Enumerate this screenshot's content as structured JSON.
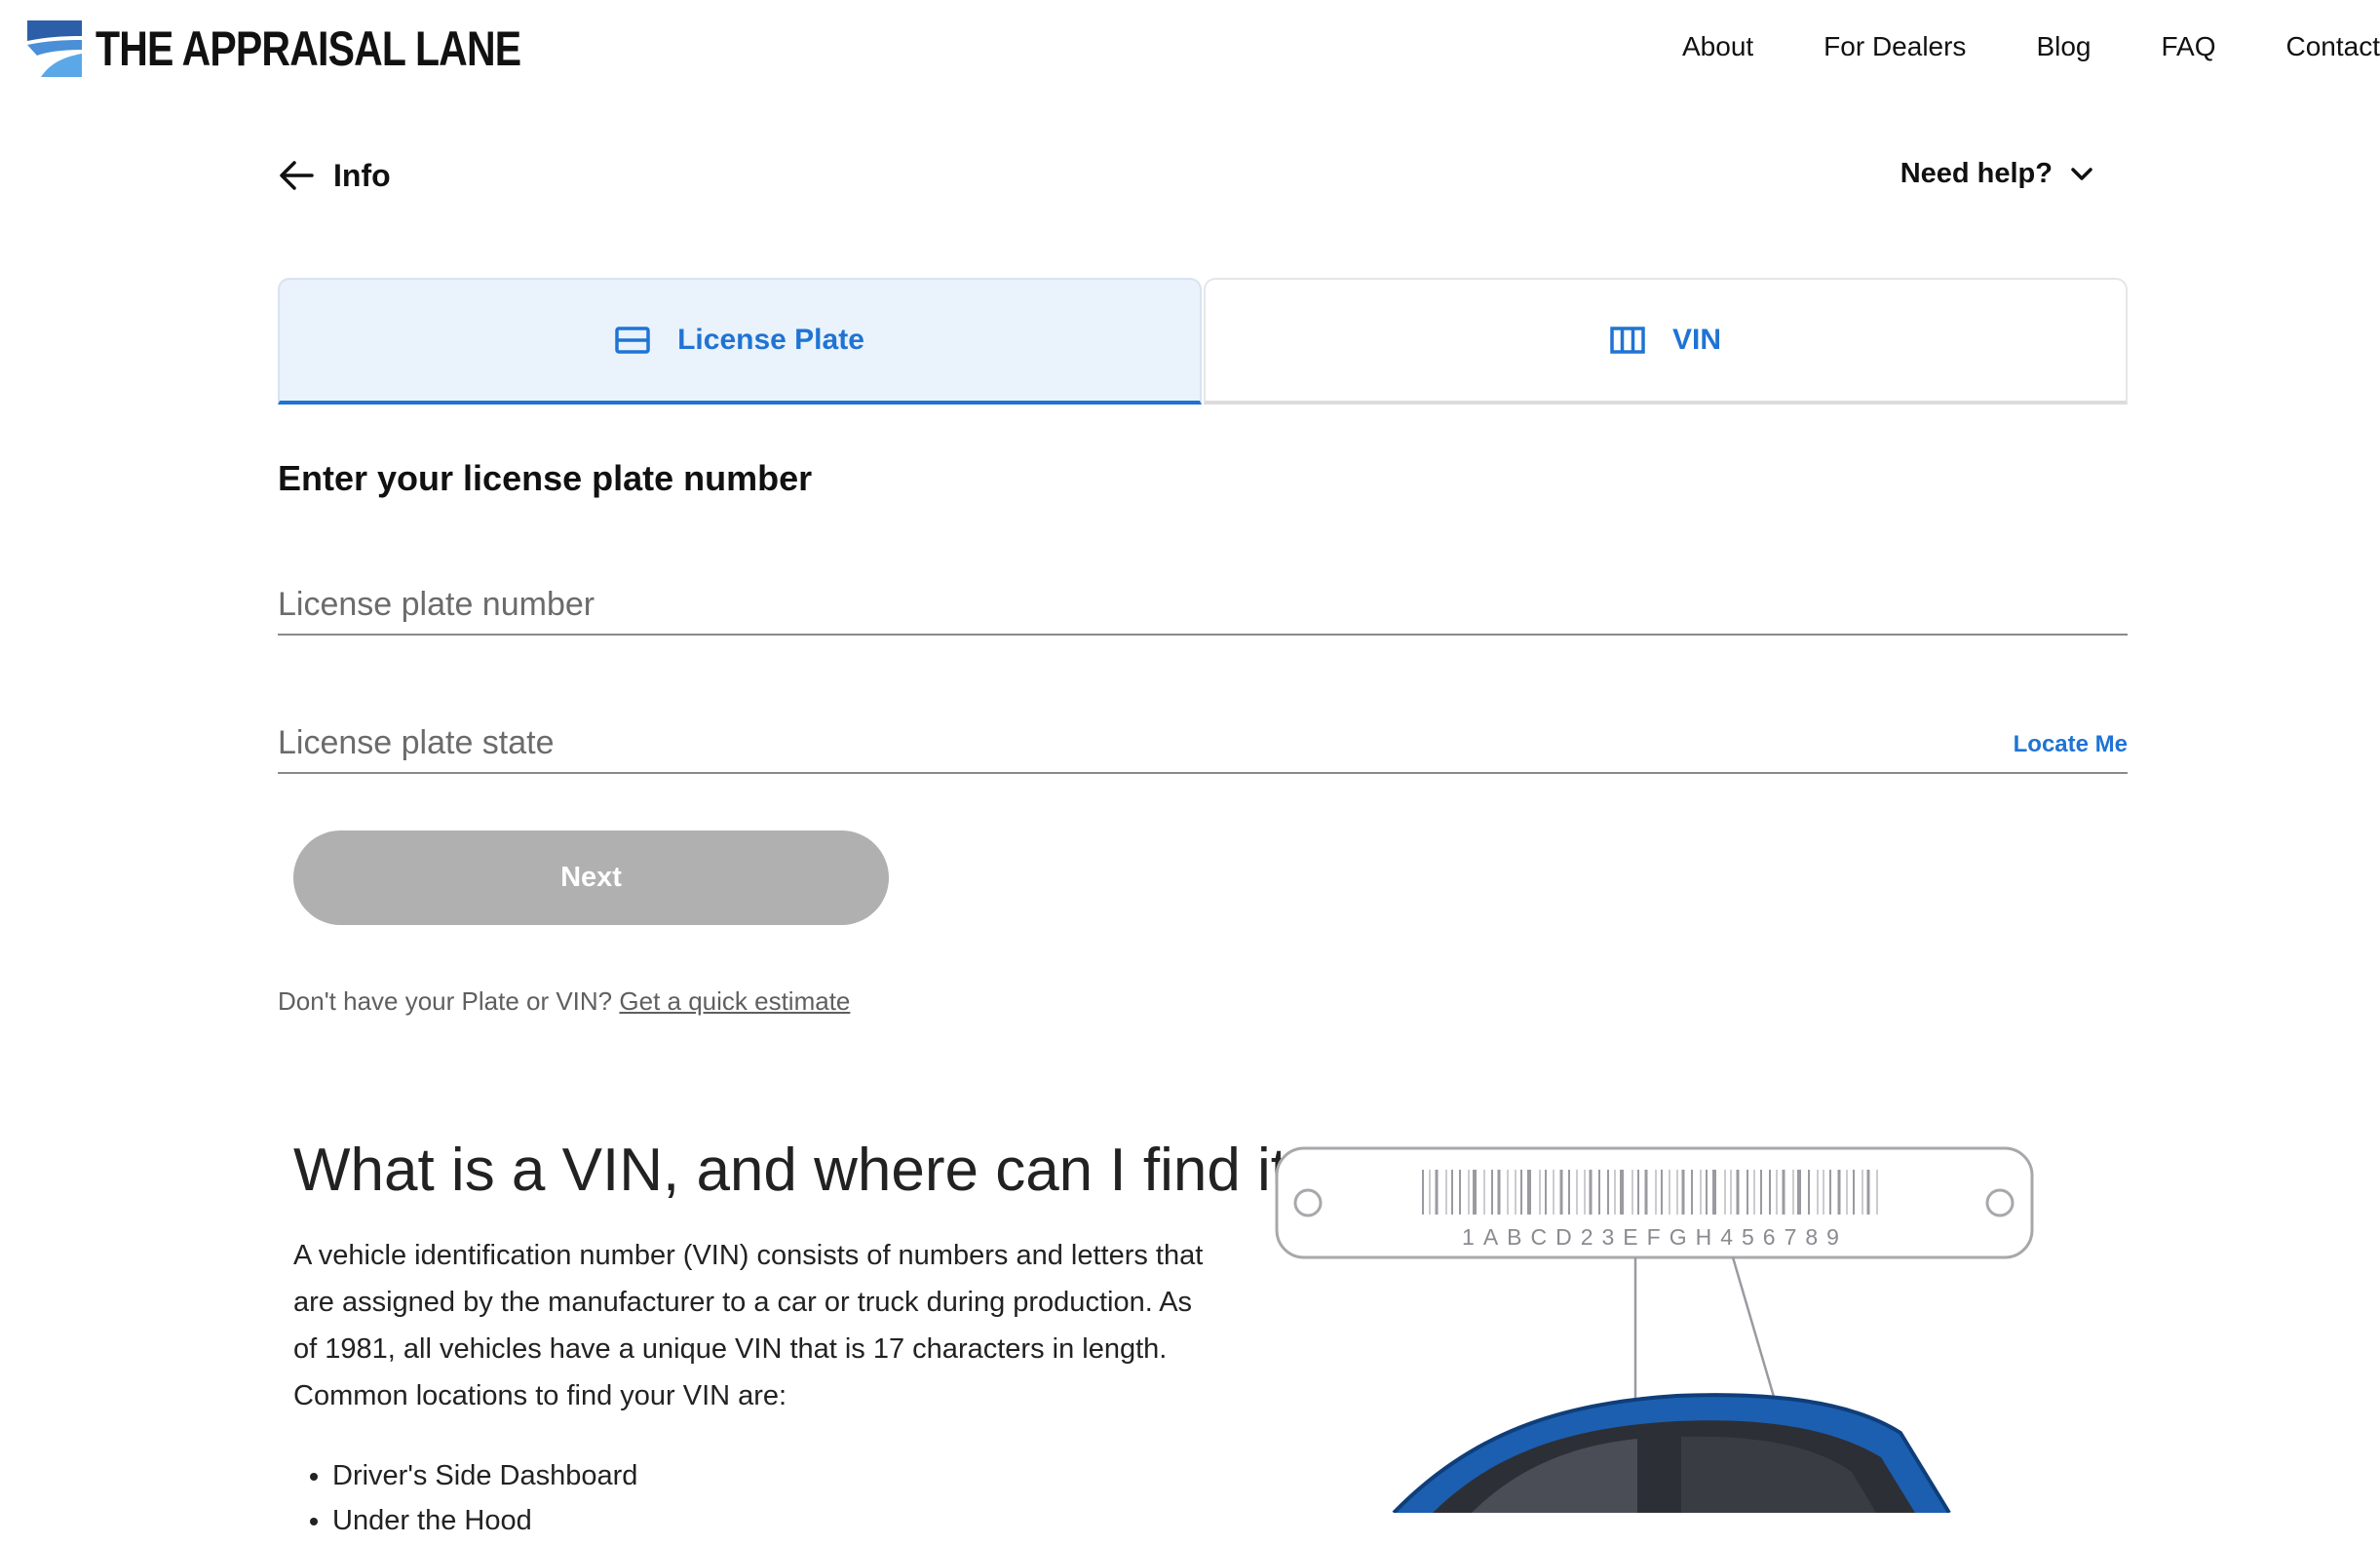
{
  "brand": {
    "name": "THE APPRAISAL LANE",
    "accent": "#1f74d3"
  },
  "nav": [
    {
      "label": "About"
    },
    {
      "label": "For Dealers"
    },
    {
      "label": "Blog"
    },
    {
      "label": "FAQ"
    },
    {
      "label": "Contact"
    }
  ],
  "back": {
    "label": "Info",
    "icon": "arrow-left-icon"
  },
  "help": {
    "label": "Need help?",
    "icon": "chevron-down-icon"
  },
  "tabs": [
    {
      "label": "License Plate",
      "icon": "license-plate-icon",
      "active": true
    },
    {
      "label": "VIN",
      "icon": "barcode-columns-icon",
      "active": false
    }
  ],
  "form": {
    "title": "Enter your license plate number",
    "plate_placeholder": "License plate number",
    "plate_value": "",
    "state_placeholder": "License plate state",
    "state_value": "",
    "locate_label": "Locate Me",
    "next_label": "Next",
    "alt_text": "Don't have your Plate or VIN?",
    "alt_link": "Get a quick estimate"
  },
  "vin_info": {
    "heading": "What is a VIN, and where can I find it?",
    "paragraph": "A vehicle identification number (VIN) consists of numbers and letters that are assigned by the manufacturer to a car or truck during production. As of 1981, all vehicles have a unique VIN that is 17 characters in length. Common locations to find your VIN are:",
    "locations": [
      "Driver's Side Dashboard",
      "Under the Hood"
    ],
    "sample_vin": "1ABCD23EFGH456789",
    "car_color": "#1c5fb0"
  }
}
